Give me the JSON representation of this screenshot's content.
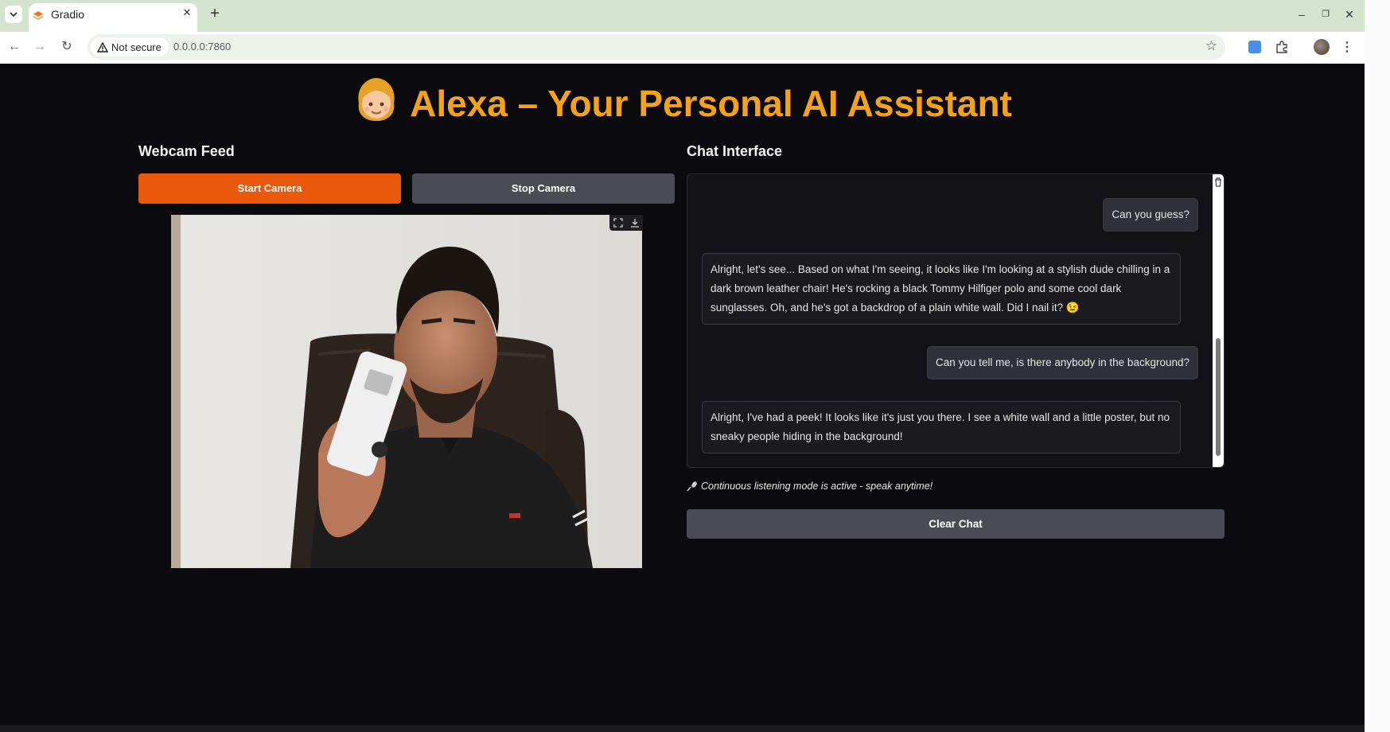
{
  "browser": {
    "tab_title": "Gradio",
    "security_label": "Not secure",
    "url": "0.0.0.0:7860"
  },
  "page": {
    "title": "Alexa – Your Personal AI Assistant",
    "title_color": "#f5a21b"
  },
  "webcam": {
    "heading": "Webcam Feed",
    "start_label": "Start Camera",
    "stop_label": "Stop Camera",
    "start_color": "#ea580c"
  },
  "chat": {
    "heading": "Chat Interface",
    "messages": [
      {
        "role": "user",
        "text": "Can you guess?"
      },
      {
        "role": "bot",
        "text": "Alright, let's see... Based on what I'm seeing, it looks like I'm looking at a stylish dude chilling in a dark brown leather chair! He's rocking a black Tommy Hilfiger polo and some cool dark sunglasses. Oh, and he's got a backdrop of a plain white wall. Did I nail it? 😉"
      },
      {
        "role": "user",
        "text": "Can you tell me, is there anybody in the background?"
      },
      {
        "role": "bot",
        "text": "Alright, I've had a peek! It looks like it's just you there. I see a white wall and a little poster, but no sneaky people hiding in the background!"
      }
    ],
    "listening_note": "Continuous listening mode is active - speak anytime!",
    "clear_label": "Clear Chat"
  }
}
